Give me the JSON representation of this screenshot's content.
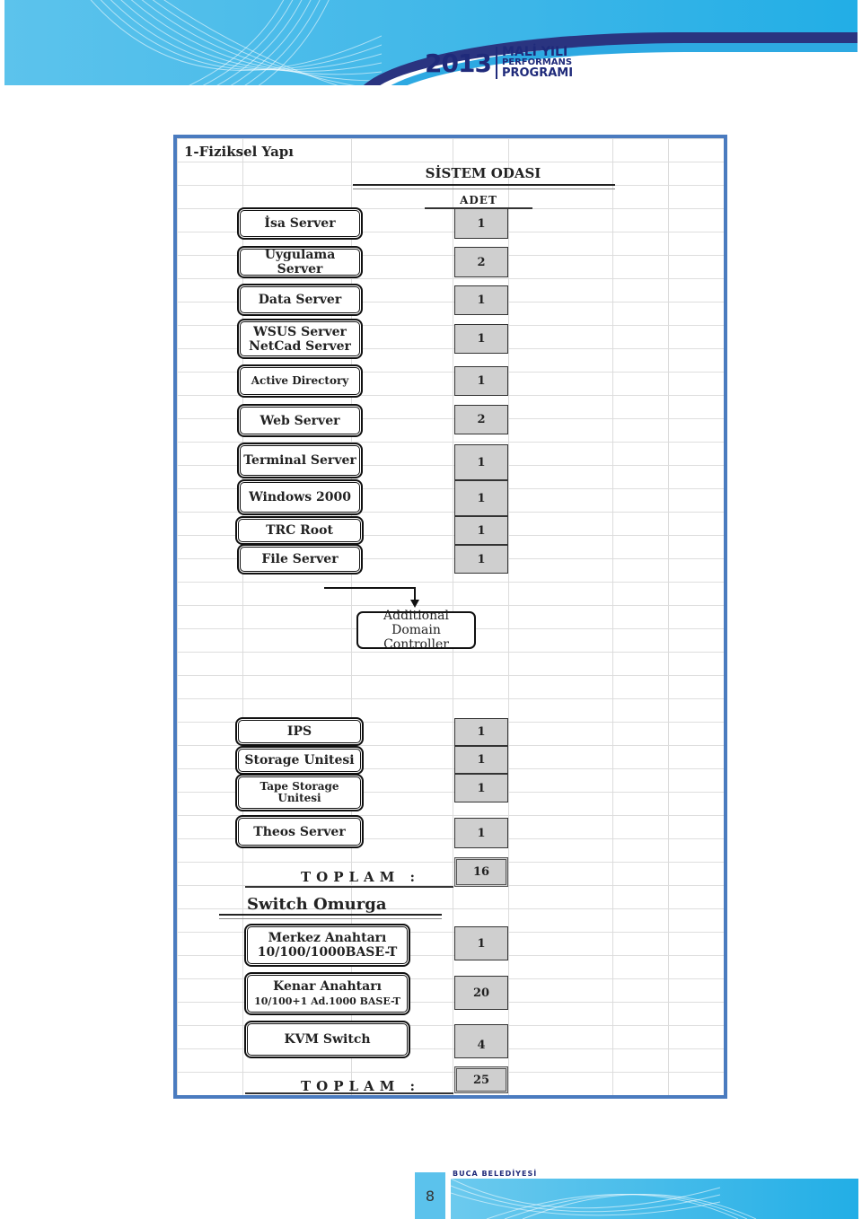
{
  "header": {
    "year": "2013",
    "line1": "MALİ YILI",
    "line2": "PERFORMANS",
    "line3": "PROGRAMI"
  },
  "section_title": "1-Fiziksel Yapı",
  "room_title": "SİSTEM ODASI",
  "count_header": "ADET",
  "servers": [
    {
      "label": "İsa Server",
      "count": "1"
    },
    {
      "label": "Uygulama Server",
      "count": "2"
    },
    {
      "label": "Data Server",
      "count": "1"
    },
    {
      "label": "WSUS Server NetCad Server",
      "line1": "WSUS Server",
      "line2": "NetCad Server",
      "count": "1"
    },
    {
      "label": "Active Directory",
      "count": "1"
    },
    {
      "label": "Web  Server",
      "count": "2"
    },
    {
      "label": "Terminal Server",
      "count": "1"
    },
    {
      "label": "Windows 2000",
      "count": "1"
    },
    {
      "label": "TRC  Root",
      "count": "1"
    },
    {
      "label": "File Server",
      "count": "1"
    }
  ],
  "additional_dc": {
    "line1": "Additional Domain",
    "line2": "Controller"
  },
  "storage": [
    {
      "label": "IPS",
      "count": "1"
    },
    {
      "label": "Storage Unitesi",
      "count": "1"
    },
    {
      "label": "Tape Storage Unitesi",
      "line1": "Tape Storage",
      "line2": "Unitesi",
      "count": "1"
    },
    {
      "label": "Theos  Server",
      "count": "1"
    }
  ],
  "total1": {
    "label": "TOPLAM :",
    "value": "16"
  },
  "switch_title": "Switch  Omurga",
  "switches": [
    {
      "line1": "Merkez  Anahtarı",
      "line2": "10/100/1000BASE-T",
      "count": "1"
    },
    {
      "line1": "Kenar  Anahtarı",
      "line2": "10/100+1 Ad.1000 BASE-T",
      "count": "20"
    },
    {
      "line1": "KVM  Switch",
      "line2": "",
      "count": "4"
    }
  ],
  "total2": {
    "label": "TOPLAM :",
    "value": "25"
  },
  "footer": {
    "org": "BUCA BELEDİYESİ",
    "page": "8"
  }
}
